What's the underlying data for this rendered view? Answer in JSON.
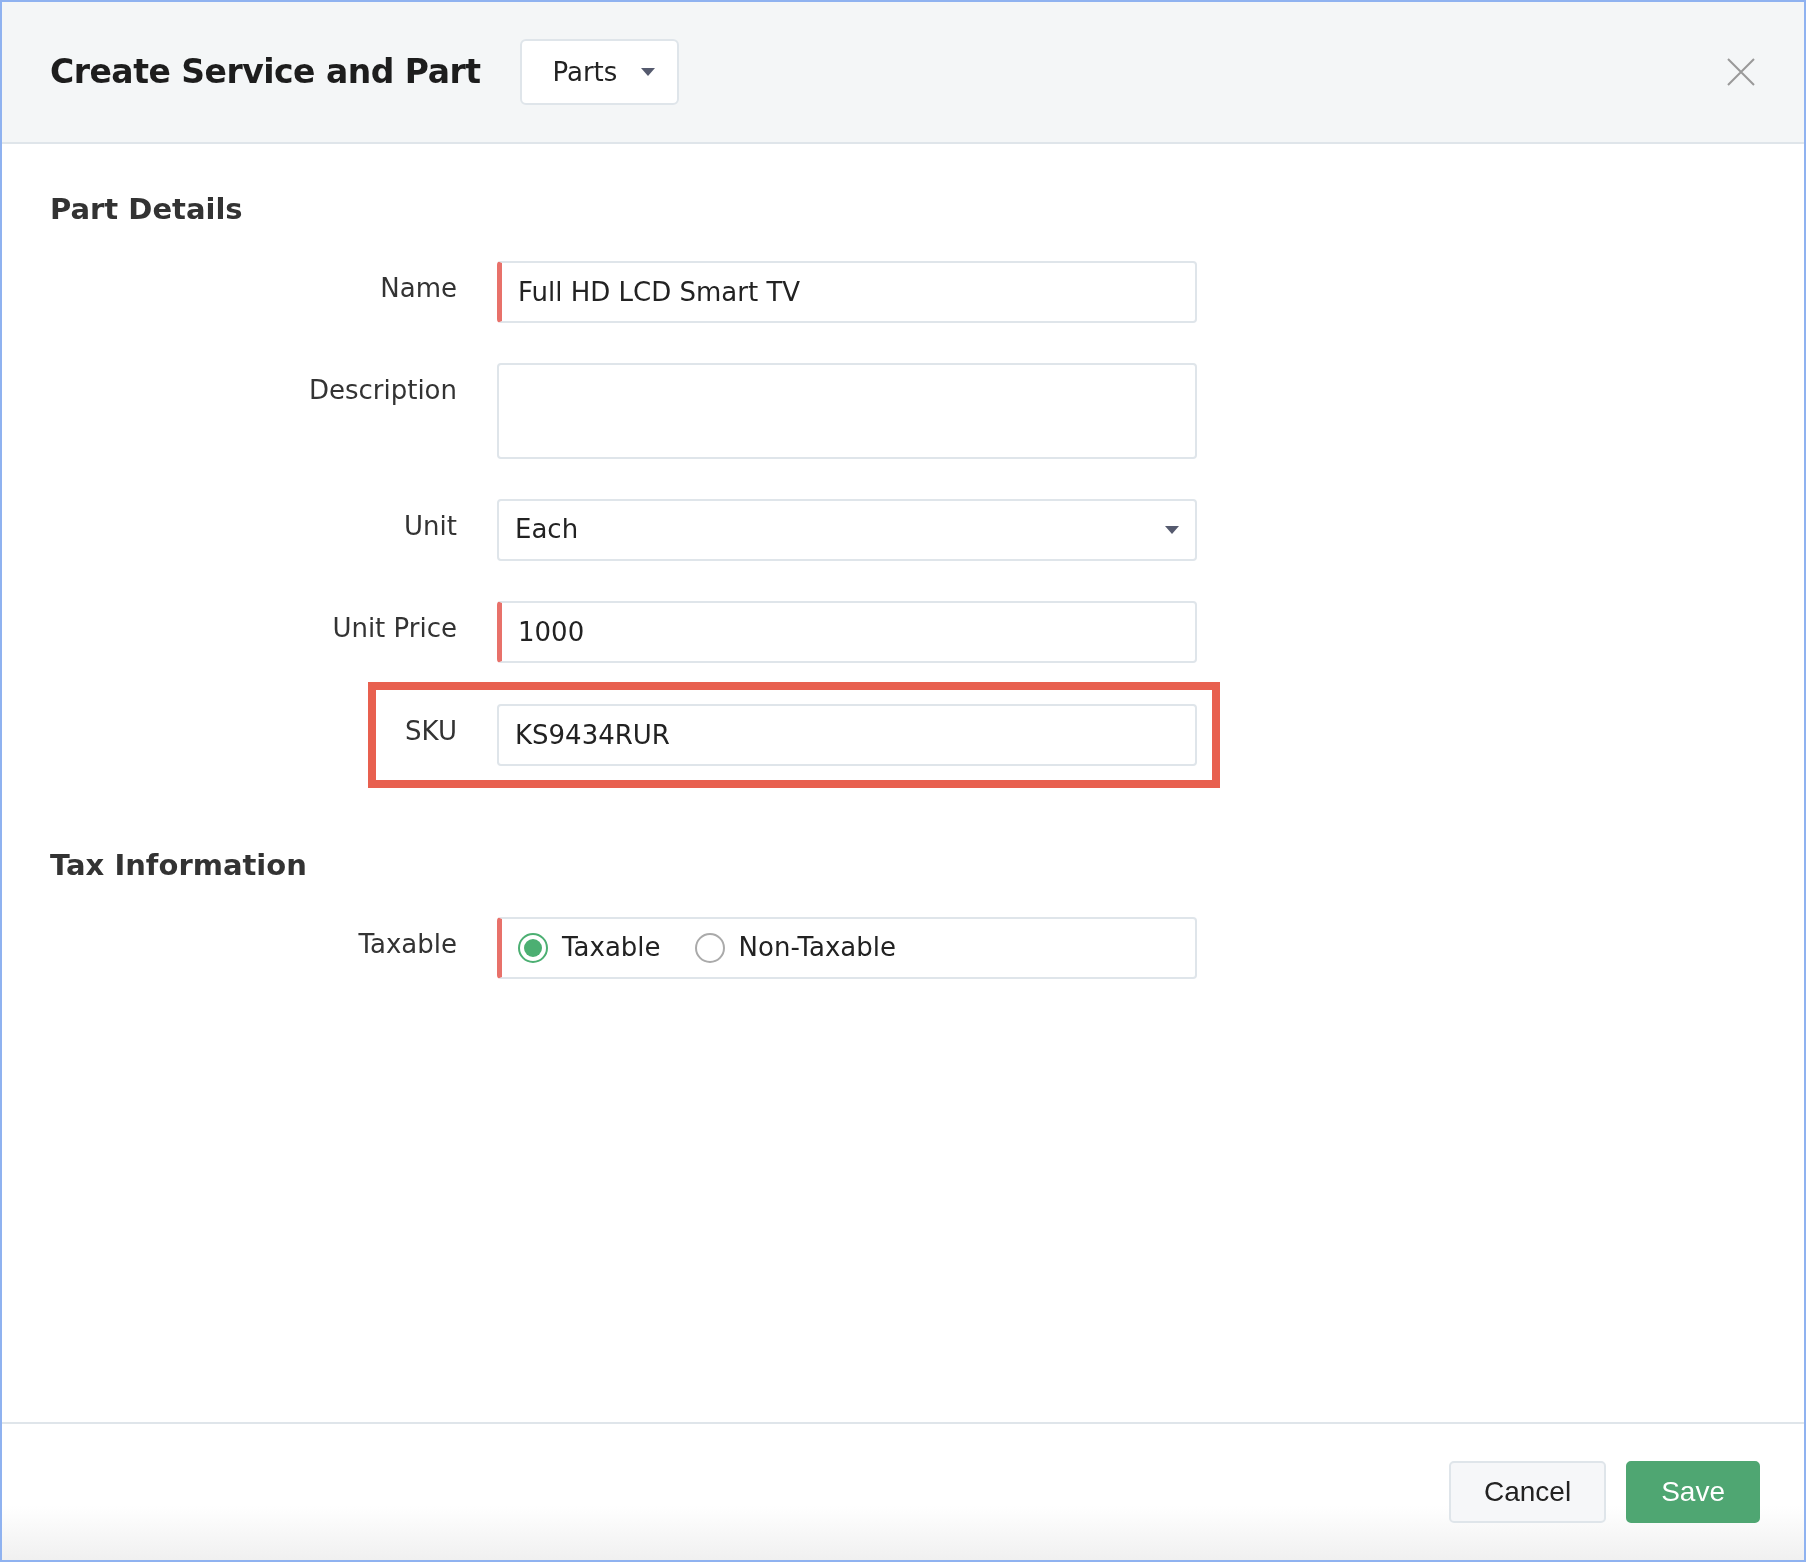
{
  "dialog": {
    "title": "Create Service and Part",
    "type_select": {
      "value": "Parts"
    }
  },
  "sections": [
    {
      "title": "Part Details",
      "fields": [
        {
          "kind": "text",
          "label": "Name",
          "value": "Full HD LCD Smart TV",
          "required": true,
          "highlighted": false
        },
        {
          "kind": "textarea",
          "label": "Description",
          "required": false,
          "highlighted": false
        },
        {
          "kind": "select",
          "label": "Unit",
          "value": "Each",
          "required": false,
          "highlighted": false
        },
        {
          "kind": "text",
          "label": "Unit Price",
          "value": "1000",
          "required": true,
          "highlighted": false
        },
        {
          "kind": "text",
          "label": "SKU",
          "value": "KS9434RUR",
          "required": false,
          "highlighted": true
        }
      ]
    },
    {
      "title": "Tax Information",
      "fields": [
        {
          "kind": "radio",
          "label": "Taxable",
          "required": true,
          "highlighted": false,
          "options": [
            {
              "label": "Taxable",
              "selected": true
            },
            {
              "label": "Non-Taxable",
              "selected": false
            }
          ]
        }
      ]
    }
  ],
  "buttons": [
    {
      "label": "Cancel",
      "kind": "secondary"
    },
    {
      "label": "Save",
      "kind": "primary"
    }
  ]
}
